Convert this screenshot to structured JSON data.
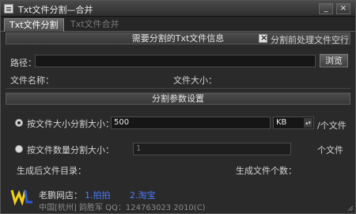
{
  "window": {
    "title": "Txt文件分割—合并",
    "minimize_glyph": "_",
    "close_glyph": "×"
  },
  "tabs": [
    {
      "label": "Txt文件分割",
      "active": true
    },
    {
      "label": "Txt文件合并",
      "active": false
    }
  ],
  "file_info": {
    "section_title": "需要分割的Txt文件信息",
    "preprocess_checkbox_label": "分割前处理文件空行",
    "preprocess_checked": true,
    "path_label": "路径：",
    "path_value": "",
    "browse_label": "浏览",
    "filename_label": "文件名称：",
    "filesize_label": "文件大小："
  },
  "split_params": {
    "section_title": "分割参数设置",
    "by_size": {
      "label": "按文件大小分割大小：",
      "value": "500",
      "unit": "KB",
      "suffix": "/个文件",
      "selected": true
    },
    "by_count": {
      "label": "按文件数量分割大小：",
      "value": "1",
      "suffix": "个文件",
      "selected": false
    },
    "output_dir_label": "生成后文件目录：",
    "output_count_label": "生成文件个数："
  },
  "footer": {
    "shop_label": "老鹏网店：",
    "link1": "1.拍拍",
    "link2": "2.淘宝",
    "author": "中国[杭州] 韵胜军  QQ：124763023  2010(C)"
  },
  "colors": {
    "link": "#4a7cff",
    "logo_yellow": "#f2d21a",
    "logo_blue": "#2d57d6"
  }
}
